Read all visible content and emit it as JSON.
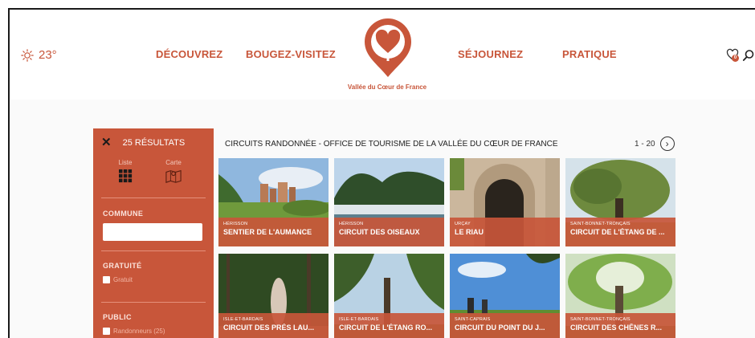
{
  "header": {
    "weather_temp": "23°",
    "weather_icon": "sun-icon",
    "nav": [
      "DÉCOUVREZ",
      "BOUGEZ-VISITEZ",
      "SÉJOURNEZ",
      "PRATIQUE"
    ],
    "logo_text": "Vallée du Cœur de France",
    "favorites_count": "0",
    "favorites_icon": "heart-icon",
    "search_icon": "search-icon"
  },
  "sidebar": {
    "results_count": "25 RÉSULTATS",
    "view_list": "Liste",
    "view_map": "Carte",
    "commune_title": "COMMUNE",
    "commune_value": "",
    "gratuite_title": "GRATUITÉ",
    "gratuite_option": "Gratuit",
    "public_title": "PUBLIC",
    "public_option": "Randonneurs (25)"
  },
  "results": {
    "title": "CIRCUITS RANDONNÉE - OFFICE DE TOURISME DE LA VALLÉE DU CŒUR DE FRANCE",
    "pager": "1 - 20",
    "cards": [
      {
        "place": "HÉRISSON",
        "name": "SENTIER DE L'AUMANCE"
      },
      {
        "place": "HÉRISSON",
        "name": "CIRCUIT DES OISEAUX"
      },
      {
        "place": "URÇAY",
        "name": "LE RIAU"
      },
      {
        "place": "SAINT-BONNET-TRONÇAIS",
        "name": "CIRCUIT DE L'ÉTANG DE ..."
      },
      {
        "place": "ISLE-ET-BARDAIS",
        "name": "CIRCUIT DES PRÉS LAU..."
      },
      {
        "place": "ISLE-ET-BARDAIS",
        "name": "CIRCUIT DE L'ÉTANG RO..."
      },
      {
        "place": "SAINT-CAPRAIS",
        "name": "CIRCUIT DU POINT DU J..."
      },
      {
        "place": "SAINT-BONNET-TRONÇAIS",
        "name": "CIRCUIT DES CHÊNES R..."
      }
    ]
  },
  "colors": {
    "brand": "#c8563a"
  }
}
